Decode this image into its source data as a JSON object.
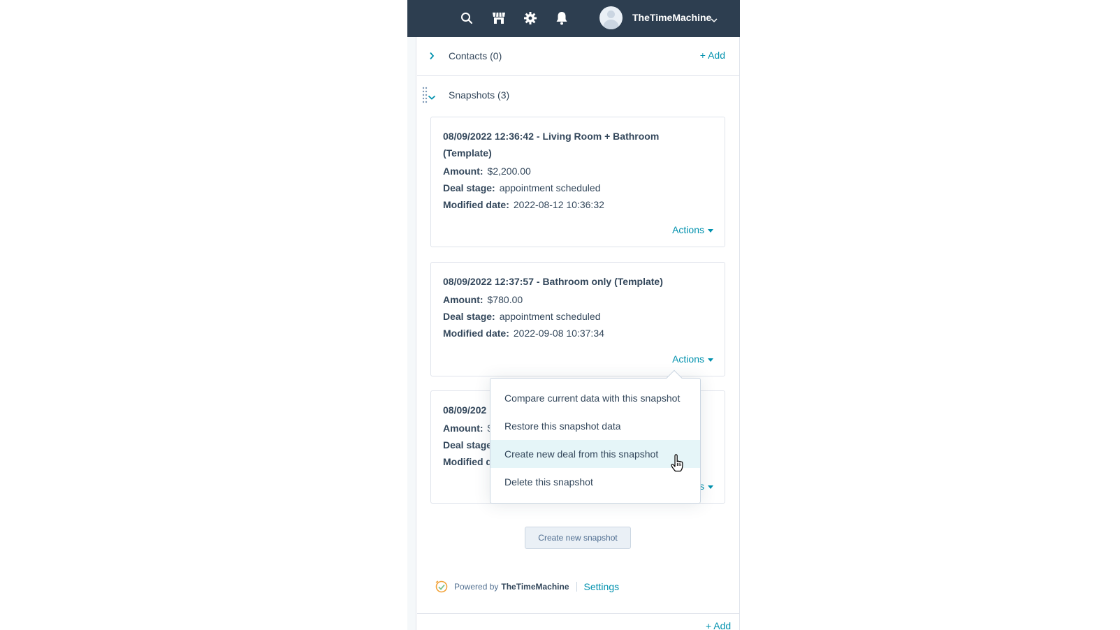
{
  "topbar": {
    "icons": [
      "search-icon",
      "marketplace-icon",
      "gear-icon",
      "bell-icon"
    ],
    "username": "TheTimeMachine"
  },
  "contacts": {
    "title": "Contacts (0)",
    "add_label": "+ Add"
  },
  "snapshots": {
    "title": "Snapshots (3)",
    "labels": {
      "amount": "Amount:",
      "deal_stage": "Deal stage:",
      "modified_date": "Modified date:"
    },
    "actions_label": "Actions",
    "items": [
      {
        "title": "08/09/2022 12:36:42 - Living Room + Bathroom (Template)",
        "amount": "$2,200.00",
        "deal_stage": "appointment scheduled",
        "modified_date": "2022-08-12 10:36:32"
      },
      {
        "title": "08/09/2022 12:37:57 - Bathroom only (Template)",
        "amount": "$780.00",
        "deal_stage": "appointment scheduled",
        "modified_date": "2022-09-08 10:37:34"
      },
      {
        "title_visible": "08/09/202",
        "amount_visible": "$",
        "deal_stage_label_visible": "Deal stage",
        "modified_label_visible": "Modified d",
        "actions_visible": "s"
      }
    ]
  },
  "menu": {
    "items": [
      "Compare current data with this snapshot",
      "Restore this snapshot data",
      "Create new deal from this snapshot",
      "Delete this snapshot"
    ]
  },
  "create_button_label": "Create new snapshot",
  "footer": {
    "powered_by": "Powered by",
    "brand": "TheTimeMachine",
    "settings_label": "Settings"
  },
  "bottom_peek": "+ Add",
  "colors": {
    "topbar": "#2d3e50",
    "link": "#0091ae",
    "text": "#33475b",
    "border": "#dfe3eb",
    "hover": "#e5f5f8"
  }
}
